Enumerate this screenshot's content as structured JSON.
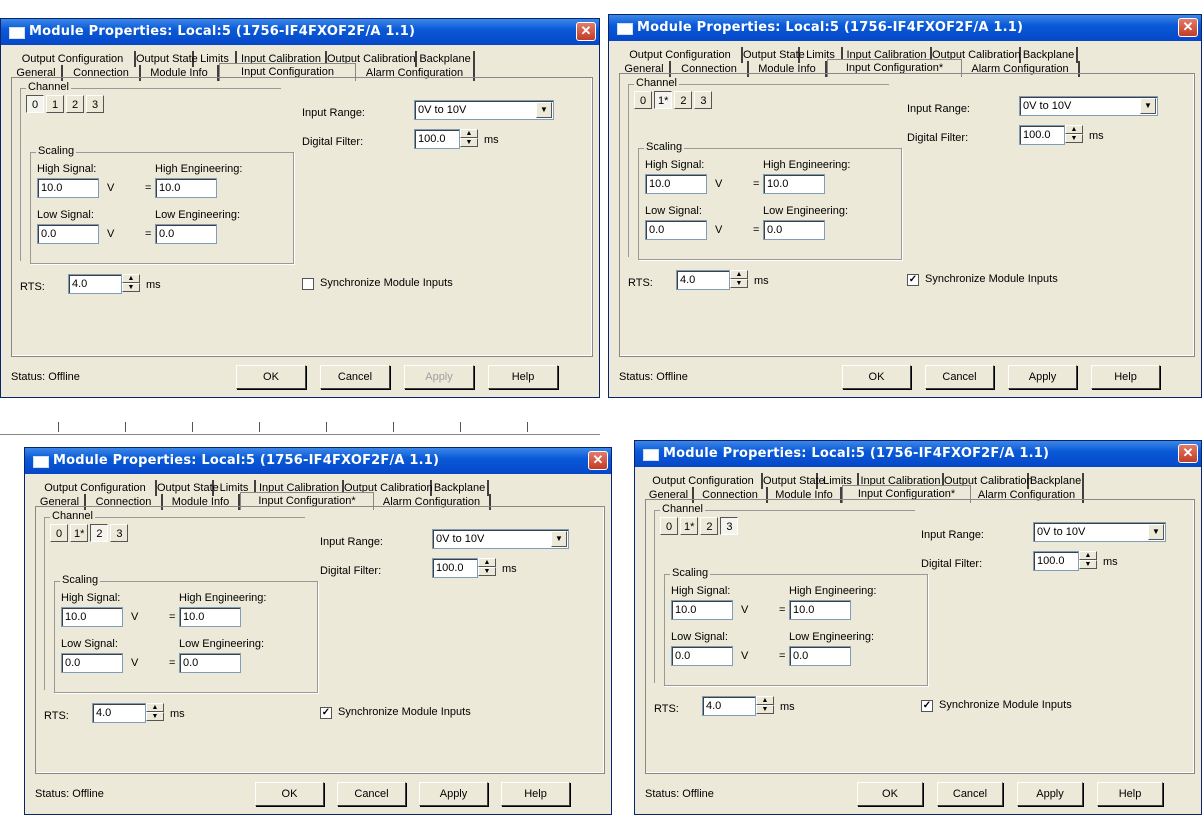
{
  "title": "Module Properties: Local:5 (1756-IF4FXOF2F/A 1.1)",
  "close_glyph": "✕",
  "dialogs": [
    {
      "tabs_row1": [
        "Output Configuration",
        "Output State",
        "Limits",
        "Input Calibration",
        "Output Calibration",
        "Backplane"
      ],
      "tabs_row2": [
        "General",
        "Connection",
        "Module Info",
        "Input Configuration",
        "Alarm Configuration"
      ],
      "channel_label": "Channel",
      "channels": [
        "0",
        "1",
        "2",
        "3"
      ],
      "selected_channel": 0,
      "scaling_label": "Scaling",
      "high_signal_label": "High Signal:",
      "high_signal": "10.0",
      "high_signal_unit": "V",
      "high_eng_label": "High Engineering:",
      "high_eng": "10.0",
      "low_signal_label": "Low Signal:",
      "low_signal": "0.0",
      "low_signal_unit": "V",
      "low_eng_label": "Low Engineering:",
      "low_eng": "0.0",
      "equals": "=",
      "input_range_label": "Input Range:",
      "input_range": "0V to 10V",
      "digital_filter_label": "Digital Filter:",
      "digital_filter": "100.0",
      "filter_unit": "ms",
      "rts_label": "RTS:",
      "rts": "4.0",
      "rts_unit": "ms",
      "sync_label": "Synchronize Module Inputs",
      "sync_checked": "",
      "status": "Status:  Offline",
      "ok": "OK",
      "cancel": "Cancel",
      "apply": "Apply",
      "help": "Help",
      "apply_disabled": true
    },
    {
      "tabs_row1": [
        "Output Configuration",
        "Output State",
        "Limits",
        "Input Calibration",
        "Output Calibration",
        "Backplane"
      ],
      "tabs_row2": [
        "General",
        "Connection",
        "Module Info",
        "Input Configuration*",
        "Alarm Configuration"
      ],
      "channel_label": "Channel",
      "channels": [
        "0",
        "1*",
        "2",
        "3"
      ],
      "selected_channel": 1,
      "scaling_label": "Scaling",
      "high_signal_label": "High Signal:",
      "high_signal": "10.0",
      "high_signal_unit": "V",
      "high_eng_label": "High Engineering:",
      "high_eng": "10.0",
      "low_signal_label": "Low Signal:",
      "low_signal": "0.0",
      "low_signal_unit": "V",
      "low_eng_label": "Low Engineering:",
      "low_eng": "0.0",
      "equals": "=",
      "input_range_label": "Input Range:",
      "input_range": "0V to 10V",
      "digital_filter_label": "Digital Filter:",
      "digital_filter": "100.0",
      "filter_unit": "ms",
      "rts_label": "RTS:",
      "rts": "4.0",
      "rts_unit": "ms",
      "sync_label": "Synchronize Module Inputs",
      "sync_checked": "✓",
      "status": "Status:  Offline",
      "ok": "OK",
      "cancel": "Cancel",
      "apply": "Apply",
      "help": "Help",
      "apply_disabled": false
    },
    {
      "tabs_row1": [
        "Output Configuration",
        "Output State",
        "Limits",
        "Input Calibration",
        "Output Calibration",
        "Backplane"
      ],
      "tabs_row2": [
        "General",
        "Connection",
        "Module Info",
        "Input Configuration*",
        "Alarm Configuration"
      ],
      "channel_label": "Channel",
      "channels": [
        "0",
        "1*",
        "2",
        "3"
      ],
      "selected_channel": 2,
      "scaling_label": "Scaling",
      "high_signal_label": "High Signal:",
      "high_signal": "10.0",
      "high_signal_unit": "V",
      "high_eng_label": "High Engineering:",
      "high_eng": "10.0",
      "low_signal_label": "Low Signal:",
      "low_signal": "0.0",
      "low_signal_unit": "V",
      "low_eng_label": "Low Engineering:",
      "low_eng": "0.0",
      "equals": "=",
      "input_range_label": "Input Range:",
      "input_range": "0V to 10V",
      "digital_filter_label": "Digital Filter:",
      "digital_filter": "100.0",
      "filter_unit": "ms",
      "rts_label": "RTS:",
      "rts": "4.0",
      "rts_unit": "ms",
      "sync_label": "Synchronize Module Inputs",
      "sync_checked": "✓",
      "status": "Status:  Offline",
      "ok": "OK",
      "cancel": "Cancel",
      "apply": "Apply",
      "help": "Help",
      "apply_disabled": false
    },
    {
      "tabs_row1": [
        "Output Configuration",
        "Output State",
        "Limits",
        "Input Calibration",
        "Output Calibration",
        "Backplane"
      ],
      "tabs_row2": [
        "General",
        "Connection",
        "Module Info",
        "Input Configuration*",
        "Alarm Configuration"
      ],
      "channel_label": "Channel",
      "channels": [
        "0",
        "1*",
        "2",
        "3"
      ],
      "selected_channel": 3,
      "scaling_label": "Scaling",
      "high_signal_label": "High Signal:",
      "high_signal": "10.0",
      "high_signal_unit": "V",
      "high_eng_label": "High Engineering:",
      "high_eng": "10.0",
      "low_signal_label": "Low Signal:",
      "low_signal": "0.0",
      "low_signal_unit": "V",
      "low_eng_label": "Low Engineering:",
      "low_eng": "0.0",
      "equals": "=",
      "input_range_label": "Input Range:",
      "input_range": "0V to 10V",
      "digital_filter_label": "Digital Filter:",
      "digital_filter": "100.0",
      "filter_unit": "ms",
      "rts_label": "RTS:",
      "rts": "4.0",
      "rts_unit": "ms",
      "sync_label": "Synchronize Module Inputs",
      "sync_checked": "✓",
      "status": "Status:  Offline",
      "ok": "OK",
      "cancel": "Cancel",
      "apply": "Apply",
      "help": "Help",
      "apply_disabled": false
    }
  ]
}
